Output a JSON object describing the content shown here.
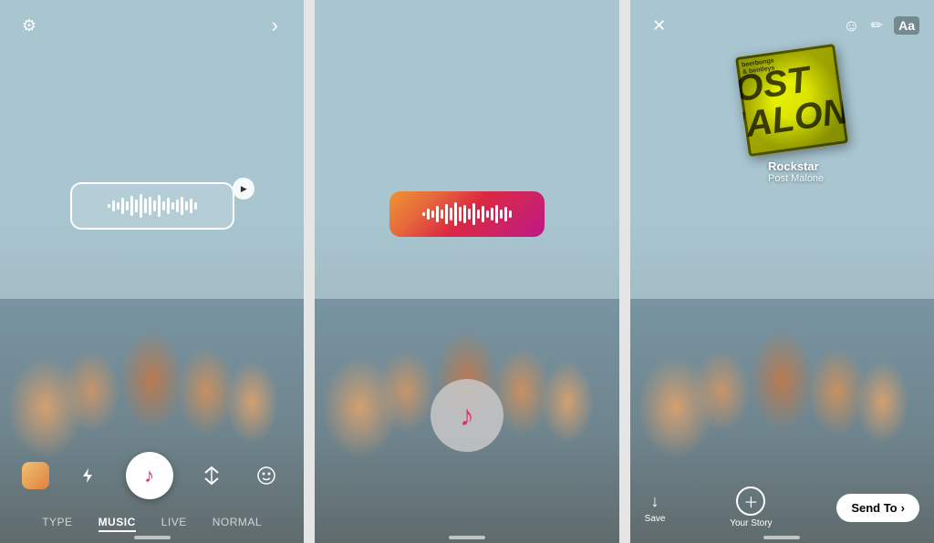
{
  "panels": [
    {
      "id": "panel1",
      "type": "camera_music",
      "top_icons": {
        "settings": "⚙",
        "chevron": "›"
      },
      "music_sticker": {
        "visible": true,
        "style": "outline_white"
      },
      "tabs": [
        "TYPE",
        "MUSIC",
        "LIVE",
        "NORMAL"
      ],
      "active_tab": "MUSIC"
    },
    {
      "id": "panel2",
      "type": "music_selected",
      "music_sticker": {
        "visible": true,
        "style": "gradient_pink"
      }
    },
    {
      "id": "panel3",
      "type": "sticker_added",
      "top_icons": {
        "close": "✕",
        "emoji": "☺",
        "pencil": "✏",
        "text": "Aa"
      },
      "album": {
        "title": "Rockstar",
        "artist": "Post Malone",
        "art_color": "#d4e000"
      },
      "bottom_bar": {
        "save_label": "Save",
        "your_story_label": "Your Story",
        "send_to_label": "Send To",
        "send_to_chevron": "›"
      }
    }
  ],
  "waveform": {
    "bars": [
      4,
      12,
      8,
      18,
      10,
      22,
      14,
      26,
      16,
      20,
      12,
      24,
      10,
      18,
      8,
      14,
      20,
      10,
      16,
      8
    ]
  }
}
